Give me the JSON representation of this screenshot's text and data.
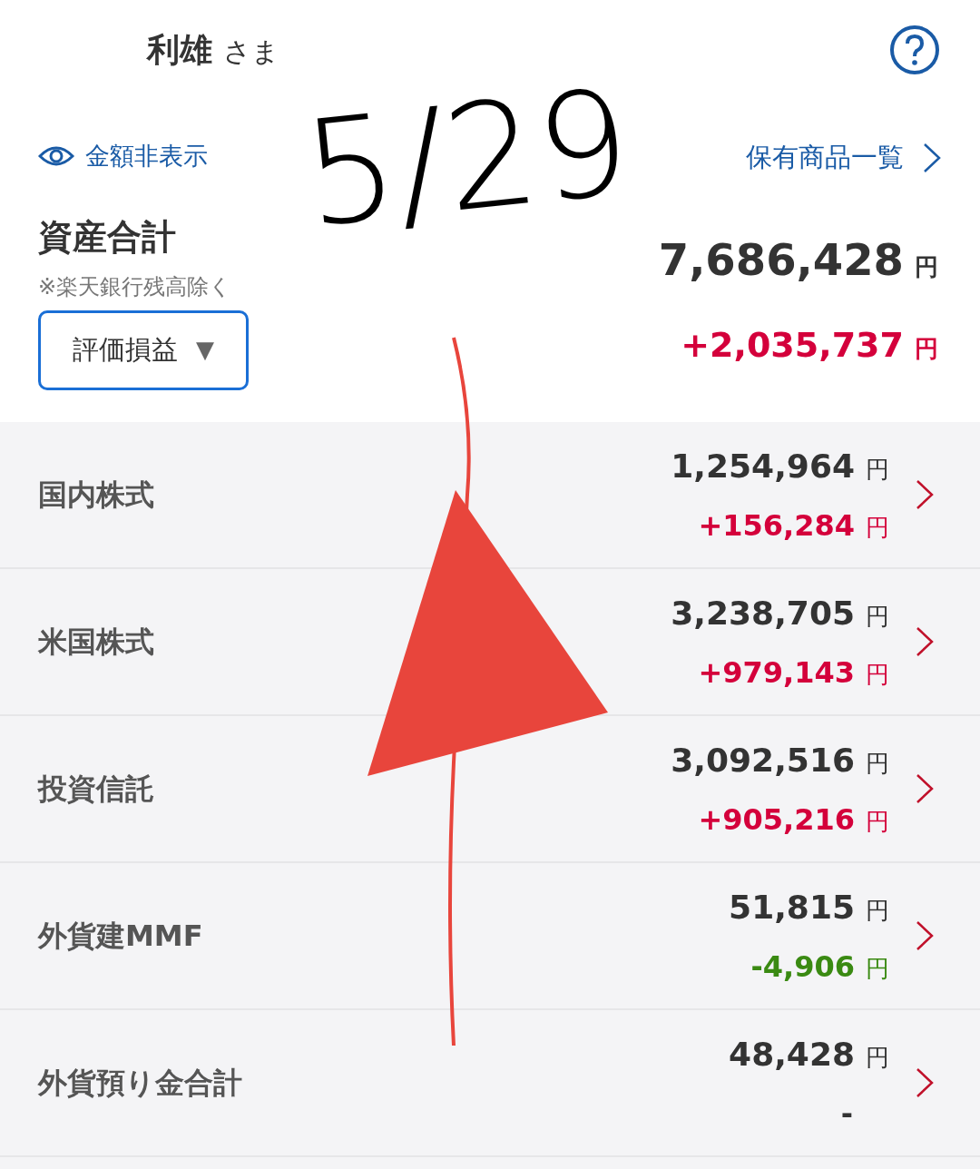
{
  "header": {
    "name": "利雄",
    "honorific": "さま"
  },
  "summary": {
    "hide_amounts": "金額非表示",
    "holdings_link": "保有商品一覧",
    "title": "資産合計",
    "note": "※楽天銀行残高除く",
    "dropdown": "評価損益",
    "dropdown_caret": "▼",
    "total": "7,686,428",
    "total_unit": "円",
    "change": "+2,035,737",
    "change_unit": "円"
  },
  "rows": [
    {
      "label": "国内株式",
      "value": "1,254,964",
      "unit": "円",
      "change": "+156,284",
      "change_unit": "円",
      "color": "#d4003b"
    },
    {
      "label": "米国株式",
      "value": "3,238,705",
      "unit": "円",
      "change": "+979,143",
      "change_unit": "円",
      "color": "#d4003b"
    },
    {
      "label": "投資信託",
      "value": "3,092,516",
      "unit": "円",
      "change": "+905,216",
      "change_unit": "円",
      "color": "#d4003b"
    },
    {
      "label": "外貨建MMF",
      "value": "51,815",
      "unit": "円",
      "change": "-4,906",
      "change_unit": "円",
      "color": "#3a8a12"
    },
    {
      "label": "外貨預り金合計",
      "value": "48,428",
      "unit": "円",
      "change": "-",
      "color": "#333333"
    }
  ],
  "annotation": {
    "text": "5/29"
  }
}
